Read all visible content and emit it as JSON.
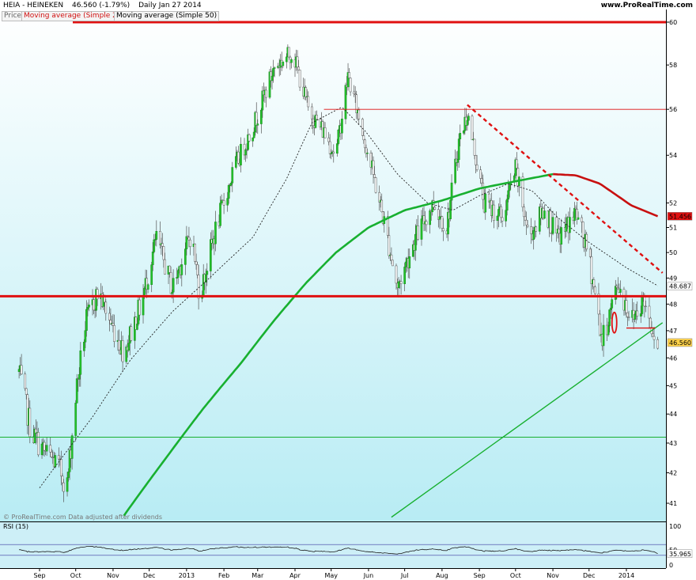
{
  "header": {
    "instrument": "HEIA - HEINEKEN",
    "last_change": "46.560 (-1.79%)",
    "period_date": "Daily  Jan 27 2014",
    "site": "www.ProRealTime.com"
  },
  "legend": {
    "price": "Price",
    "ma200": "Moving average (Simple 200)",
    "ma50": "Moving average (Simple 50)"
  },
  "watermark": "© ProRealTime.com Data adjusted after dividends",
  "rsi_label": "RSI (15)",
  "chart_data": {
    "type": "candlestick",
    "x_months": [
      "Sep",
      "Oct",
      "Nov",
      "Dec",
      "2013",
      "Feb",
      "Mar",
      "Apr",
      "May",
      "Jun",
      "Jul",
      "Aug",
      "Sep",
      "Oct",
      "Nov",
      "Dec",
      "2014"
    ],
    "y_ticks": [
      41,
      42,
      43,
      44,
      45,
      46,
      47,
      48,
      49,
      50,
      51,
      52,
      54,
      56,
      58,
      60
    ],
    "ylim": [
      40.6,
      60.2
    ],
    "y_scale": "log",
    "price_path": [
      {
        "d": "2012-08-15",
        "v": 45.5
      },
      {
        "d": "2012-08-25",
        "v": 43.4
      },
      {
        "d": "2012-09-05",
        "v": 42.7
      },
      {
        "d": "2012-09-15",
        "v": 42.3
      },
      {
        "d": "2012-09-24",
        "v": 41.6
      },
      {
        "d": "2012-10-02",
        "v": 45.0
      },
      {
        "d": "2012-10-10",
        "v": 47.4
      },
      {
        "d": "2012-10-20",
        "v": 48.5
      },
      {
        "d": "2012-10-30",
        "v": 47.3
      },
      {
        "d": "2012-11-10",
        "v": 46.2
      },
      {
        "d": "2012-11-25",
        "v": 48.1
      },
      {
        "d": "2012-12-07",
        "v": 50.6
      },
      {
        "d": "2012-12-20",
        "v": 48.6
      },
      {
        "d": "2013-01-05",
        "v": 50.8
      },
      {
        "d": "2013-01-12",
        "v": 48.3
      },
      {
        "d": "2013-01-25",
        "v": 50.9
      },
      {
        "d": "2013-02-10",
        "v": 53.5
      },
      {
        "d": "2013-02-25",
        "v": 55.2
      },
      {
        "d": "2013-03-15",
        "v": 57.9
      },
      {
        "d": "2013-03-30",
        "v": 58.6
      },
      {
        "d": "2013-04-12",
        "v": 56.0
      },
      {
        "d": "2013-04-25",
        "v": 55.0
      },
      {
        "d": "2013-05-05",
        "v": 54.0
      },
      {
        "d": "2013-05-15",
        "v": 57.5
      },
      {
        "d": "2013-06-01",
        "v": 54.0
      },
      {
        "d": "2013-06-15",
        "v": 51.0
      },
      {
        "d": "2013-06-25",
        "v": 48.6
      },
      {
        "d": "2013-07-10",
        "v": 50.6
      },
      {
        "d": "2013-07-25",
        "v": 52.0
      },
      {
        "d": "2013-08-05",
        "v": 51.0
      },
      {
        "d": "2013-08-15",
        "v": 54.6
      },
      {
        "d": "2013-08-22",
        "v": 55.8
      },
      {
        "d": "2013-09-05",
        "v": 52.0
      },
      {
        "d": "2013-09-20",
        "v": 51.4
      },
      {
        "d": "2013-10-01",
        "v": 53.4
      },
      {
        "d": "2013-10-12",
        "v": 50.6
      },
      {
        "d": "2013-10-25",
        "v": 51.8
      },
      {
        "d": "2013-11-05",
        "v": 50.5
      },
      {
        "d": "2013-11-20",
        "v": 51.6
      },
      {
        "d": "2013-12-01",
        "v": 49.8
      },
      {
        "d": "2013-12-12",
        "v": 46.6
      },
      {
        "d": "2013-12-25",
        "v": 48.8
      },
      {
        "d": "2014-01-05",
        "v": 47.4
      },
      {
        "d": "2014-01-15",
        "v": 48.2
      },
      {
        "d": "2014-01-27",
        "v": 46.56
      }
    ],
    "ma50_path": [
      {
        "d": "2012-09-01",
        "v": 41.5
      },
      {
        "d": "2012-09-25",
        "v": 42.8
      },
      {
        "d": "2012-10-15",
        "v": 43.9
      },
      {
        "d": "2012-11-15",
        "v": 45.9
      },
      {
        "d": "2012-12-20",
        "v": 47.7
      },
      {
        "d": "2013-01-20",
        "v": 49.0
      },
      {
        "d": "2013-02-25",
        "v": 50.6
      },
      {
        "d": "2013-03-25",
        "v": 53.0
      },
      {
        "d": "2013-04-15",
        "v": 55.4
      },
      {
        "d": "2013-05-10",
        "v": 56.1
      },
      {
        "d": "2013-05-30",
        "v": 55.0
      },
      {
        "d": "2013-06-25",
        "v": 53.2
      },
      {
        "d": "2013-07-20",
        "v": 52.0
      },
      {
        "d": "2013-08-10",
        "v": 51.7
      },
      {
        "d": "2013-09-01",
        "v": 52.3
      },
      {
        "d": "2013-09-25",
        "v": 52.8
      },
      {
        "d": "2013-10-15",
        "v": 52.5
      },
      {
        "d": "2013-11-05",
        "v": 51.4
      },
      {
        "d": "2013-12-01",
        "v": 50.4
      },
      {
        "d": "2014-01-01",
        "v": 49.4
      },
      {
        "d": "2014-01-27",
        "v": 48.7
      }
    ],
    "ma200_path": [
      {
        "d": "2012-11-10",
        "v": 40.6
      },
      {
        "d": "2012-12-15",
        "v": 42.5
      },
      {
        "d": "2013-01-15",
        "v": 44.2
      },
      {
        "d": "2013-02-15",
        "v": 45.8
      },
      {
        "d": "2013-03-15",
        "v": 47.4
      },
      {
        "d": "2013-04-10",
        "v": 48.8
      },
      {
        "d": "2013-05-05",
        "v": 50.0
      },
      {
        "d": "2013-06-01",
        "v": 51.0
      },
      {
        "d": "2013-07-01",
        "v": 51.7
      },
      {
        "d": "2013-08-01",
        "v": 52.1
      },
      {
        "d": "2013-09-01",
        "v": 52.6
      },
      {
        "d": "2013-10-01",
        "v": 52.9
      },
      {
        "d": "2013-11-01",
        "v": 53.2
      },
      {
        "d": "2013-11-20",
        "v": 53.15
      },
      {
        "d": "2013-12-10",
        "v": 52.8
      },
      {
        "d": "2014-01-05",
        "v": 51.9
      },
      {
        "d": "2014-01-27",
        "v": 51.456
      }
    ],
    "annotations": {
      "resistance_level": 60.0,
      "support_level": 48.3,
      "high_line_level": 56.0,
      "high_line_start": "2013-04-25",
      "low_line_level": 43.2,
      "short_line": {
        "start": "2014-01-01",
        "end": "2014-01-25",
        "v": 47.1
      },
      "downtrend": {
        "start": {
          "d": "2013-08-22",
          "v": 56.2
        },
        "end": {
          "d": "2014-01-31",
          "v": 49.2
        }
      },
      "uptrend": {
        "start": {
          "d": "2013-06-20",
          "v": 40.55
        },
        "end": {
          "d": "2014-01-31",
          "v": 47.3
        }
      },
      "ellipse": {
        "d": "2013-12-22",
        "v": 47.3
      }
    },
    "price_labels": [
      {
        "text": "51.456",
        "v": 51.456,
        "color": "#e01010"
      },
      {
        "text": "48.687",
        "v": 48.687,
        "color": "#ffffff"
      },
      {
        "text": "46.560",
        "v": 46.56,
        "color": "#ffd24a"
      }
    ],
    "rsi": {
      "ticks": [
        100,
        50,
        0
      ],
      "levels": [
        70,
        30
      ],
      "last_label": "35.965",
      "last": 35.965
    }
  }
}
